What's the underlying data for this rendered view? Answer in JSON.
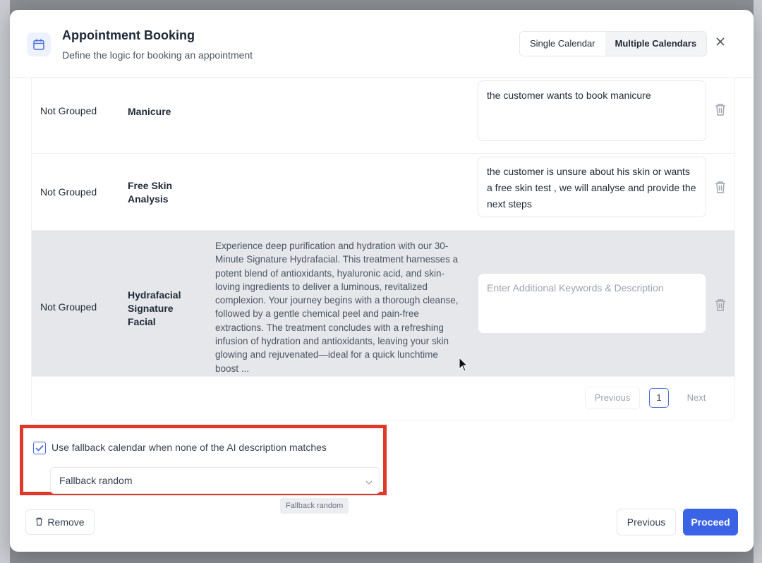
{
  "header": {
    "title": "Appointment Booking",
    "subtitle": "Define the logic for booking an appointment",
    "icon": "calendar-icon",
    "toggle": [
      "Single Calendar",
      "Multiple Calendars"
    ],
    "toggle_active": "Multiple Calendars",
    "close_icon": "close-icon"
  },
  "rows": [
    {
      "group": "Not Grouped",
      "name": "Manicure",
      "description": "",
      "keywords": "the customer wants to book manicure",
      "keywords_placeholder": ""
    },
    {
      "group": "Not Grouped",
      "name": "Free Skin Analysis",
      "description": "",
      "keywords": "the customer is unsure about his skin or wants a free skin test , we will analyse and provide the next steps",
      "keywords_placeholder": ""
    },
    {
      "group": "Not Grouped",
      "name": "Hydrafacial Signature Facial",
      "description": "Experience deep purification and hydration with our 30-Minute Signature Hydrafacial. This treatment harnesses a potent blend of antioxidants, hyaluronic acid, and skin-loving ingredients to deliver a luminous, revitalized complexion. Your journey begins with a thorough cleanse, followed by a gentle chemical peel and pain-free extractions. The treatment concludes with a refreshing infusion of hydration and antioxidants, leaving your skin glowing and rejuvenated—ideal for a quick lunchtime boost ...",
      "keywords": "",
      "keywords_placeholder": "Enter Additional Keywords & Description"
    }
  ],
  "pagination": {
    "previous": "Previous",
    "page": "1",
    "next": "Next"
  },
  "fallback": {
    "checkbox_label": "Use fallback calendar when none of the AI description matches",
    "checked": true,
    "select_value": "Fallback random",
    "tooltip": "Fallback random"
  },
  "footer": {
    "remove": "Remove",
    "previous": "Previous",
    "proceed": "Proceed"
  },
  "colors": {
    "primary": "#3b63e6",
    "highlight_border": "#e0392b"
  }
}
